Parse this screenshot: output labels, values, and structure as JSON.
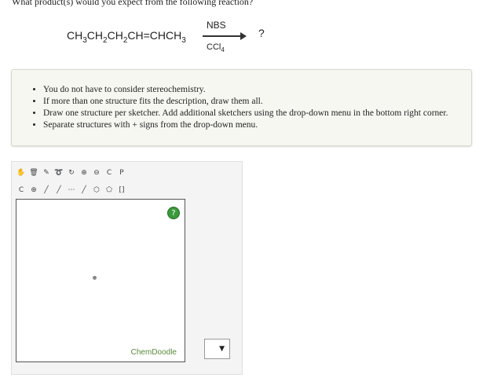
{
  "question": "What product(s) would you expect from the following reaction?",
  "reaction": {
    "reactant_html_parts": [
      "CH",
      "3",
      "CH",
      "2",
      "CH",
      "2",
      "CH=CHCH",
      "3"
    ],
    "reagent_top": "NBS",
    "reagent_bottom_main": "CCl",
    "reagent_bottom_sub": "4",
    "product": "?"
  },
  "notes": [
    "You do not have to consider stereochemistry.",
    "If more than one structure fits the description, draw them all.",
    "Draw one structure per sketcher. Add additional sketchers using the drop-down menu in the bottom right corner.",
    "Separate structures with + signs from the drop-down menu."
  ],
  "sketcher": {
    "help_label": "?",
    "brand": "ChemDoodle",
    "dropdown_arrow": "▼",
    "toolbar_row1": [
      "hand-icon",
      "trash-icon",
      "eraser-icon",
      "lasso-icon",
      "ring-move-icon",
      "zoom-in-icon",
      "zoom-out-icon",
      "clean-icon",
      "perspective-icon"
    ],
    "toolbar_row2": [
      "element-c-icon",
      "charge-icon",
      "single-bond-icon",
      "wedge-bond-icon",
      "hash-bond-icon",
      "bold-bond-icon",
      "ring-icon",
      "template-icon",
      "bracket-icon"
    ],
    "row1_glyphs": [
      "✋",
      "🗑",
      "✎",
      "➰",
      "↻",
      "⊕",
      "⊖",
      "C",
      "P"
    ],
    "row2_glyphs": [
      "C",
      "⊕",
      "╱",
      "╱",
      "⋯",
      "╱",
      "⬡",
      "⬠",
      "[]"
    ]
  },
  "colors": {
    "notes_bg": "#f7f7f2",
    "help_green": "#3a9a3a",
    "brand_green": "#5a8a3a"
  }
}
